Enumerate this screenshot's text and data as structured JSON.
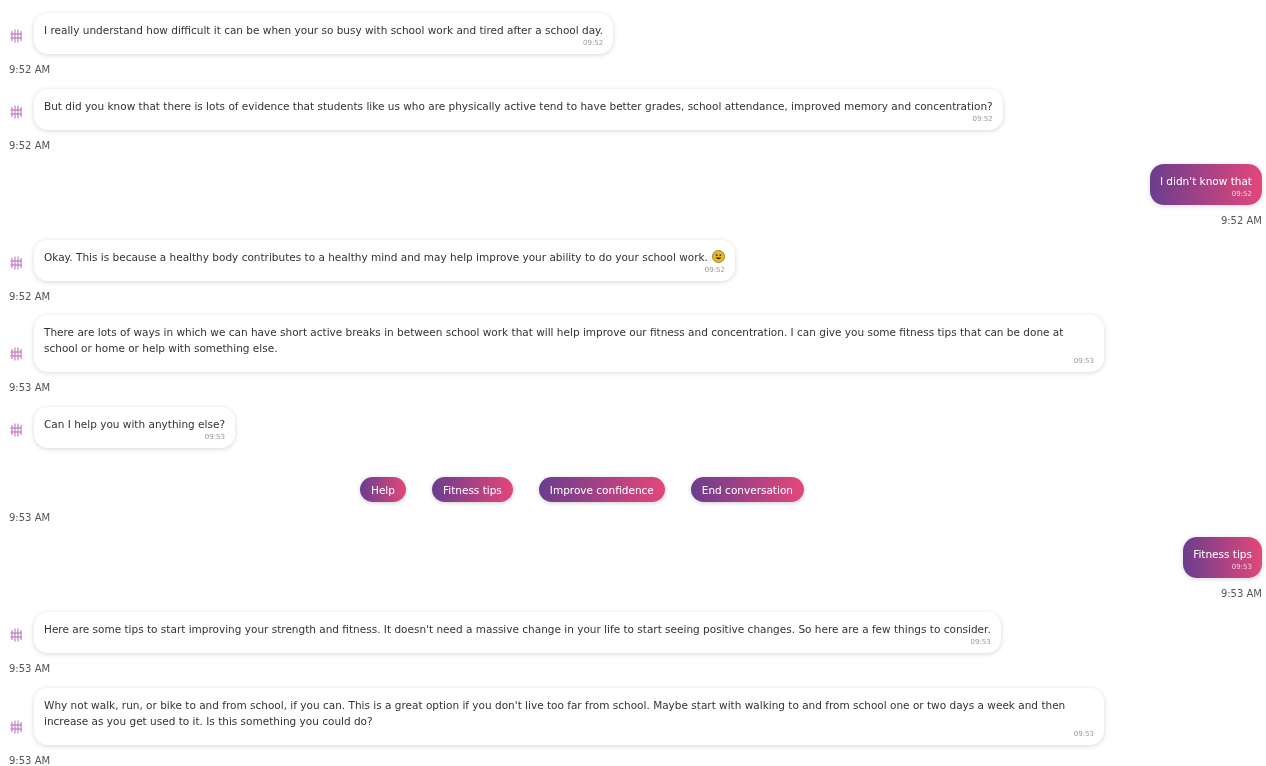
{
  "messages": [
    {
      "kind": "bot",
      "text": "I really understand how difficult it can be when your so busy with school work and tired after a school day.",
      "stamp": "09:52",
      "time": "9:52 AM"
    },
    {
      "kind": "bot",
      "text": "But did you know that there is lots of evidence that students like us who are physically active tend to have better grades, school attendance, improved memory and concentration?",
      "stamp": "09:52",
      "time": "9:52 AM"
    },
    {
      "kind": "user",
      "text": "I didn't know that",
      "stamp": "09:52",
      "time": "9:52 AM"
    },
    {
      "kind": "bot",
      "text": "Okay. This is because a healthy body contributes to a healthy mind and may help improve your ability to do your school work.",
      "ends_with_smiley": true,
      "stamp": "09:52",
      "time": "9:52 AM"
    },
    {
      "kind": "bot",
      "text": "There are lots of ways in which we can have short active breaks in between school work that will help improve our fitness and concentration. I can give you some fitness tips that can be done at school or home or help with something else.",
      "stamp": "09:53",
      "time": "9:53 AM"
    },
    {
      "kind": "bot",
      "text": "Can I help you with anything else?",
      "stamp": "09:53"
    },
    {
      "kind": "choices",
      "options": [
        "Help",
        "Fitness tips",
        "Improve confidence",
        "End conversation"
      ],
      "time": "9:53 AM"
    },
    {
      "kind": "user",
      "text": "Fitness tips",
      "stamp": "09:53",
      "time": "9:53 AM"
    },
    {
      "kind": "bot",
      "text": "Here are some tips to start improving your strength and fitness. It doesn't need a massive change in your life to start seeing positive changes. So here are a few things to consider.",
      "stamp": "09:53",
      "time": "9:53 AM"
    },
    {
      "kind": "bot",
      "text": "Why not walk, run, or bike to and from school, if you can. This is a great option if you don't live too far from school. Maybe start with walking to and from school one or two days a week and then increase as you get used to it. Is this something you could do?",
      "stamp": "09:53",
      "time": "9:53 AM"
    }
  ]
}
